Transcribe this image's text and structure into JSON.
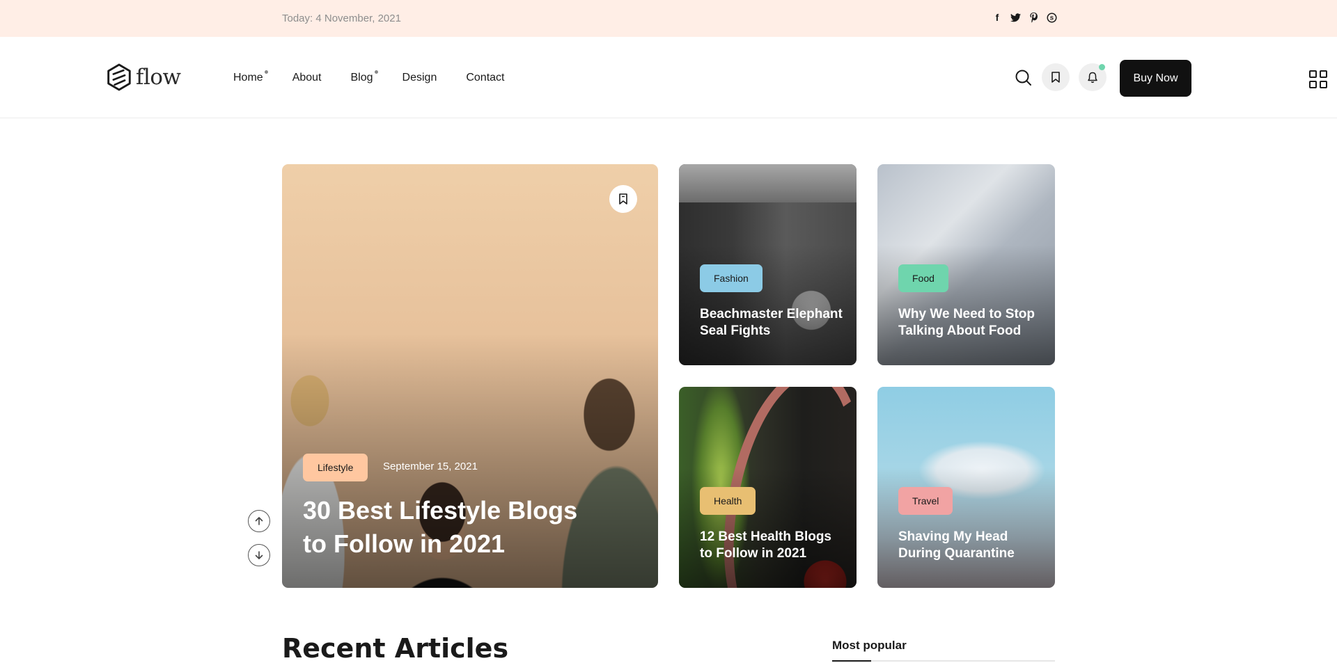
{
  "topbar": {
    "date": "Today: 4 November, 2021",
    "social_icons": [
      "facebook-icon",
      "twitter-icon",
      "pinterest-icon",
      "skype-icon"
    ]
  },
  "header": {
    "logo_text": "flow",
    "nav": [
      {
        "label": "Home",
        "has_dropdown": true
      },
      {
        "label": "About",
        "has_dropdown": false
      },
      {
        "label": "Blog",
        "has_dropdown": true
      },
      {
        "label": "Design",
        "has_dropdown": false
      },
      {
        "label": "Contact",
        "has_dropdown": false
      }
    ],
    "buy_label": "Buy Now",
    "notification_color": "#6fd5ad"
  },
  "hero": {
    "featured": {
      "category": "Lifestyle",
      "category_color": "#ffc7a0",
      "date": "September 15, 2021",
      "title": "30 Best Lifestyle Blogs to Follow in 2021"
    },
    "cards": [
      {
        "category": "Fashion",
        "category_color": "#8ccbe6",
        "title": "Beachmaster Elephant Seal Fights"
      },
      {
        "category": "Food",
        "category_color": "#6fd5ad",
        "title": "Why We Need to Stop Talking About Food"
      },
      {
        "category": "Health",
        "category_color": "#e8bf72",
        "title": "12 Best Health Blogs to Follow in 2021"
      },
      {
        "category": "Travel",
        "category_color": "#f1a3a3",
        "title": "Shaving My Head During Quarantine"
      }
    ]
  },
  "sections": {
    "recent_title": "Recent Articles",
    "popular_title": "Most popular"
  }
}
